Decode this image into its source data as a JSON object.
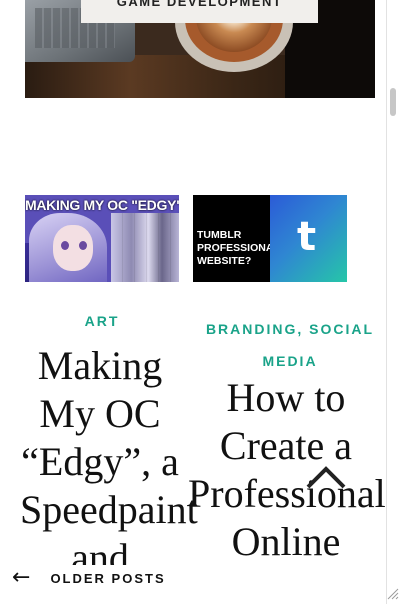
{
  "hero": {
    "label": "GAME DEVELOPMENT"
  },
  "posts": [
    {
      "thumb_title": "MAKING MY OC \"EDGY\"",
      "category": "ART",
      "title": "Making My OC “Edgy”, a Speedpaint and"
    },
    {
      "thumb_lines": [
        "TUMBLR",
        "PROFESSIONAL",
        "WEBSITE?"
      ],
      "logo_letter": "t",
      "category": "BRANDING, SOCIAL MEDIA",
      "title": "How to Create a Professional Online"
    }
  ],
  "navigation": {
    "older_label": "OLDER POSTS",
    "arrow": "←"
  },
  "icons": {
    "back_to_top": "chevron-up-icon",
    "older_posts": "arrow-left-icon"
  },
  "colors": {
    "category": "#1aa389",
    "title": "#111111"
  }
}
